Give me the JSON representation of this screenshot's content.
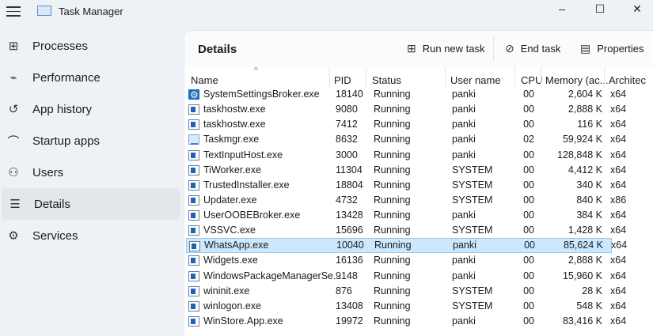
{
  "window": {
    "title": "Task Manager",
    "minimize": "–",
    "maximize": "☐",
    "close": "✕"
  },
  "nav": [
    {
      "label": "Processes",
      "icon": "processes-icon",
      "glyph": "⊞"
    },
    {
      "label": "Performance",
      "icon": "performance-icon",
      "glyph": "⌁"
    },
    {
      "label": "App history",
      "icon": "history-icon",
      "glyph": "↺"
    },
    {
      "label": "Startup apps",
      "icon": "startup-icon",
      "glyph": "⌒"
    },
    {
      "label": "Users",
      "icon": "users-icon",
      "glyph": "⚇"
    },
    {
      "label": "Details",
      "icon": "details-icon",
      "glyph": "☰",
      "active": true
    },
    {
      "label": "Services",
      "icon": "services-icon",
      "glyph": "⚙"
    }
  ],
  "panel": {
    "title": "Details",
    "run_new_task": "Run new task",
    "end_task": "End task",
    "properties": "Properties"
  },
  "columns": [
    "Name",
    "PID",
    "Status",
    "User name",
    "CPU",
    "Memory (ac...",
    "Architec"
  ],
  "rows": [
    [
      "SystemSettingsBroker.exe",
      "18140",
      "Running",
      "panki",
      "00",
      "2,604 K",
      "x64",
      "gear"
    ],
    [
      "taskhostw.exe",
      "9080",
      "Running",
      "panki",
      "00",
      "2,888 K",
      "x64",
      "app"
    ],
    [
      "taskhostw.exe",
      "7412",
      "Running",
      "panki",
      "00",
      "116 K",
      "x64",
      "app"
    ],
    [
      "Taskmgr.exe",
      "8632",
      "Running",
      "panki",
      "02",
      "59,924 K",
      "x64",
      "chart"
    ],
    [
      "TextInputHost.exe",
      "3000",
      "Running",
      "panki",
      "00",
      "128,848 K",
      "x64",
      "app"
    ],
    [
      "TiWorker.exe",
      "11304",
      "Running",
      "SYSTEM",
      "00",
      "4,412 K",
      "x64",
      "app"
    ],
    [
      "TrustedInstaller.exe",
      "18804",
      "Running",
      "SYSTEM",
      "00",
      "340 K",
      "x64",
      "app"
    ],
    [
      "Updater.exe",
      "4732",
      "Running",
      "SYSTEM",
      "00",
      "840 K",
      "x86",
      "app"
    ],
    [
      "UserOOBEBroker.exe",
      "13428",
      "Running",
      "panki",
      "00",
      "384 K",
      "x64",
      "app"
    ],
    [
      "VSSVC.exe",
      "15696",
      "Running",
      "SYSTEM",
      "00",
      "1,428 K",
      "x64",
      "app"
    ],
    [
      "WhatsApp.exe",
      "10040",
      "Running",
      "panki",
      "00",
      "85,624 K",
      "x64",
      "app"
    ],
    [
      "Widgets.exe",
      "16136",
      "Running",
      "panki",
      "00",
      "2,888 K",
      "x64",
      "app"
    ],
    [
      "WindowsPackageManagerSe...",
      "9148",
      "Running",
      "panki",
      "00",
      "15,960 K",
      "x64",
      "app"
    ],
    [
      "wininit.exe",
      "876",
      "Running",
      "SYSTEM",
      "00",
      "28 K",
      "x64",
      "app"
    ],
    [
      "winlogon.exe",
      "13408",
      "Running",
      "SYSTEM",
      "00",
      "548 K",
      "x64",
      "app"
    ],
    [
      "WinStore.App.exe",
      "19972",
      "Running",
      "panki",
      "00",
      "83,416 K",
      "x64",
      "app"
    ]
  ],
  "selected_row": "WhatsApp.exe"
}
